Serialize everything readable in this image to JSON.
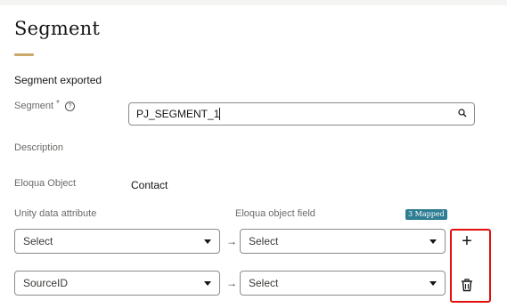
{
  "header": {
    "title": "Segment"
  },
  "form": {
    "subtitle": "Segment exported",
    "segment_label": "Segment",
    "segment_required": "*",
    "segment_help": "?",
    "segment_value": "PJ_SEGMENT_1",
    "description_label": "Description",
    "eloqua_object_label": "Eloqua Object",
    "eloqua_object_value": "Contact"
  },
  "mapping": {
    "unity_header": "Unity data attribute",
    "eloqua_header": "Eloqua object field",
    "mapped_badge": "3 Mapped",
    "arrow": "→",
    "rows": [
      {
        "unity_value": "Select",
        "eloqua_value": "Select"
      },
      {
        "unity_value": "SourceID",
        "eloqua_value": "Select"
      }
    ],
    "add_symbol": "+"
  },
  "colors": {
    "accent_underline": "#c9a96a",
    "badge_bg": "#2f7d92",
    "highlight_box": "#e30e0e"
  },
  "icons": {
    "search": "search-icon",
    "help": "help-circle-icon",
    "dropdown": "chevron-down-icon",
    "add": "plus-icon",
    "delete": "trash-icon"
  }
}
